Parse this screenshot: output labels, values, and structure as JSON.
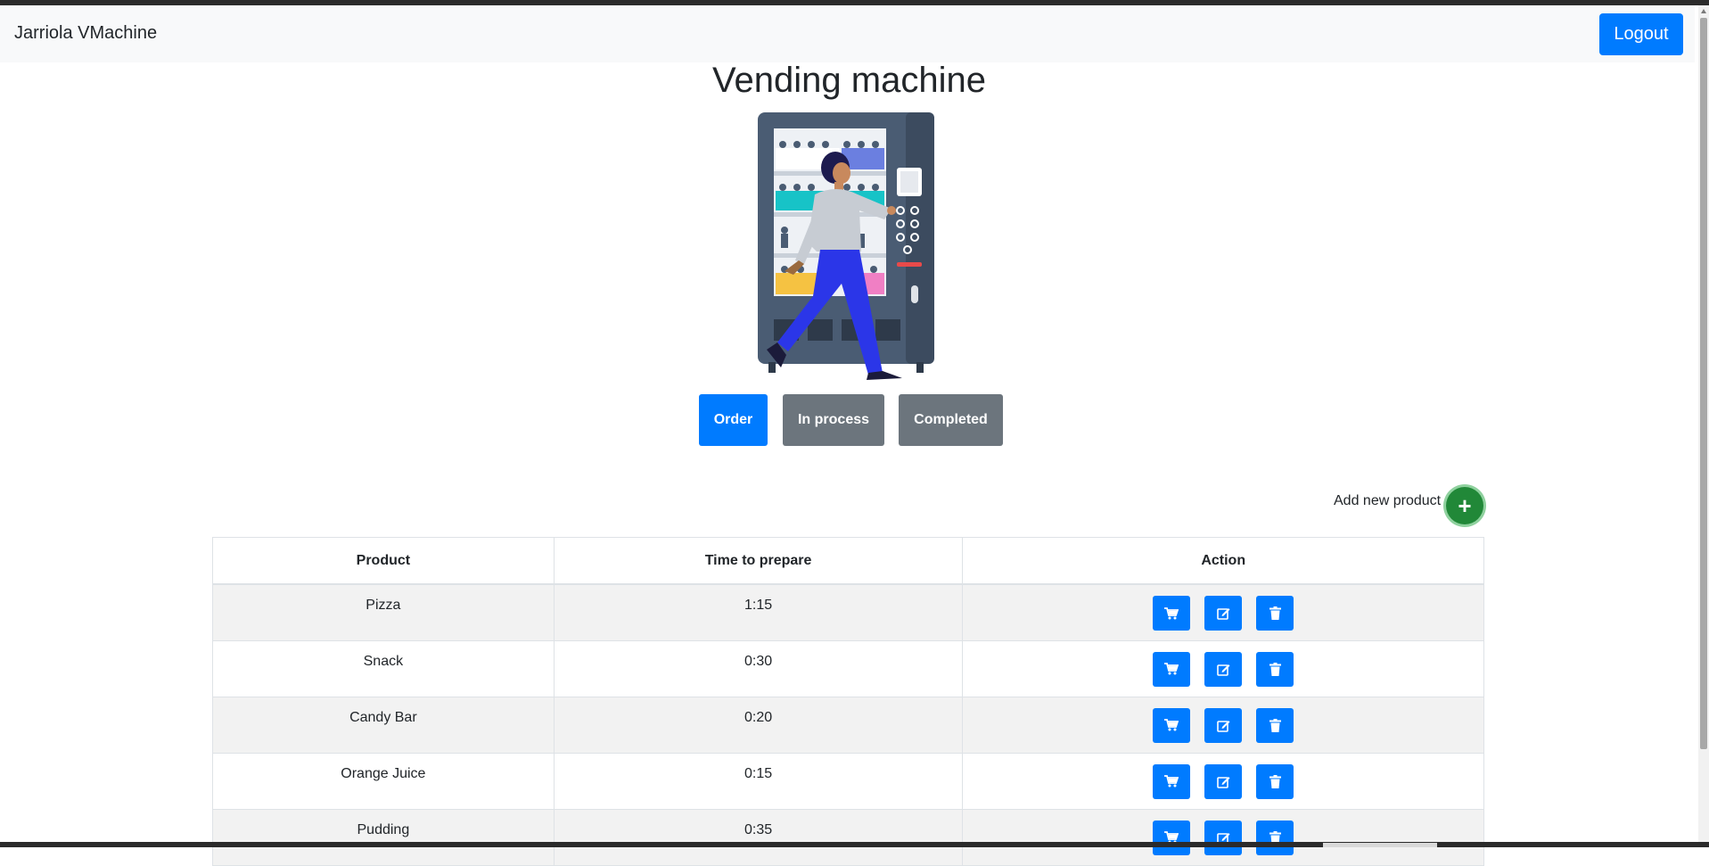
{
  "navbar": {
    "brand": "Jarriola VMachine",
    "logout_label": "Logout"
  },
  "page": {
    "title": "Vending machine"
  },
  "filters": [
    {
      "label": "Order",
      "active": true,
      "color": "#007bff"
    },
    {
      "label": "In process",
      "active": false,
      "color": "#6c757d"
    },
    {
      "label": "Completed",
      "active": false,
      "color": "#6c757d"
    }
  ],
  "add_product": {
    "label": "Add new product",
    "icon": "plus-icon",
    "color": "#218838"
  },
  "table": {
    "headers": {
      "product": "Product",
      "time": "Time to prepare",
      "action": "Action"
    },
    "rows": [
      {
        "product": "Pizza",
        "time": "1:15"
      },
      {
        "product": "Snack",
        "time": "0:30"
      },
      {
        "product": "Candy Bar",
        "time": "0:20"
      },
      {
        "product": "Orange Juice",
        "time": "0:15"
      },
      {
        "product": "Pudding",
        "time": "0:35"
      }
    ],
    "row_actions": [
      "cart-icon",
      "edit-icon",
      "trash-icon"
    ]
  },
  "colors": {
    "primary": "#007bff",
    "secondary": "#6c757d",
    "success": "#218838",
    "navbar_bg": "#f8f9fa"
  }
}
